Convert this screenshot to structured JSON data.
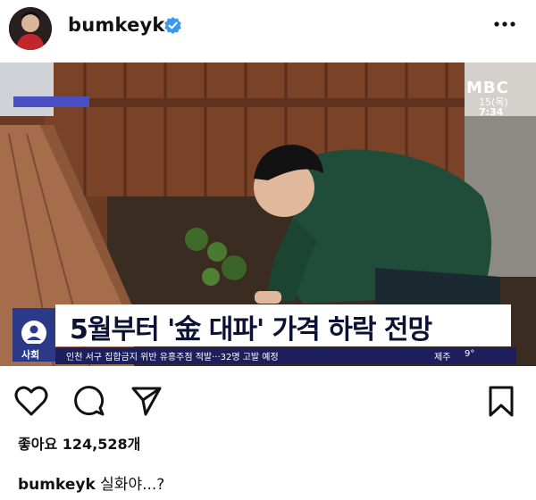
{
  "post": {
    "username": "bumkeyk",
    "verified_icon": "verified-badge-icon",
    "more_icon": "more-horizontal-icon",
    "likes_text": "좋아요 124,528개",
    "caption_user": "bumkeyk",
    "caption_text": "실화야...?"
  },
  "video": {
    "broadcaster": "MBC",
    "date": "15(목)",
    "time": "7:34",
    "headline": "5월부터 '金 대파' 가격 하락 전망",
    "section": "사회",
    "ticker": "인천 서구 집합금지 위반 유흥주점 적발···32명 고발 예정",
    "weather_location": "제주",
    "weather_temp": "9°"
  },
  "actions": {
    "like_icon": "heart-icon",
    "comment_icon": "comment-icon",
    "share_icon": "send-icon",
    "save_icon": "bookmark-icon"
  },
  "colors": {
    "accent_verified": "#3897f0",
    "news_navy": "#1c1f5c",
    "news_blue": "#2a3a86"
  }
}
